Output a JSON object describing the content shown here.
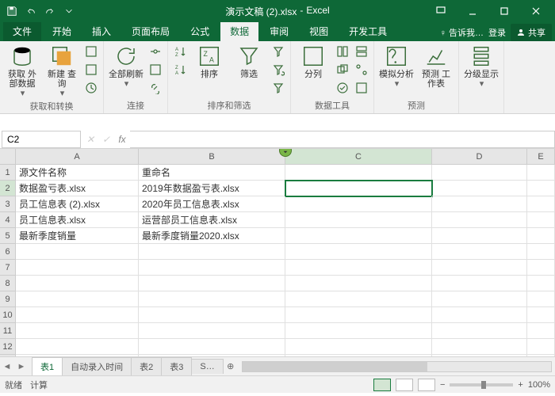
{
  "title": {
    "doc": "演示文稿 (2).xlsx",
    "app": "Excel"
  },
  "qat": {
    "save": "save-icon",
    "undo": "undo-icon",
    "redo": "redo-icon"
  },
  "tabs": {
    "file": "文件",
    "items": [
      "开始",
      "插入",
      "页面布局",
      "公式",
      "数据",
      "审阅",
      "视图",
      "开发工具"
    ],
    "active_index": 4,
    "tell_me": "告诉我…",
    "signin": "登录",
    "share": "共享"
  },
  "ribbon": {
    "groups": [
      {
        "label": "获取和转换",
        "items": [
          {
            "label": "获取\n外部数据",
            "big": true,
            "name": "get-external-data"
          },
          {
            "label": "新建\n查询",
            "big": true,
            "name": "new-query"
          }
        ]
      },
      {
        "label": "连接",
        "items": [
          {
            "label": "全部刷新",
            "big": true,
            "name": "refresh-all"
          }
        ]
      },
      {
        "label": "排序和筛选",
        "items": [
          {
            "label": "",
            "big": false,
            "name": "sort-az"
          },
          {
            "label": "",
            "big": false,
            "name": "sort-za"
          },
          {
            "label": "排序",
            "big": true,
            "name": "sort"
          },
          {
            "label": "筛选",
            "big": true,
            "name": "filter"
          }
        ]
      },
      {
        "label": "数据工具",
        "items": [
          {
            "label": "分列",
            "big": true,
            "name": "text-to-columns"
          }
        ]
      },
      {
        "label": "预测",
        "items": [
          {
            "label": "模拟分析",
            "big": true,
            "name": "what-if"
          },
          {
            "label": "预测\n工作表",
            "big": true,
            "name": "forecast-sheet"
          }
        ]
      },
      {
        "label": "分级显示",
        "items": [
          {
            "label": "分级显示",
            "big": true,
            "name": "outline"
          }
        ]
      }
    ]
  },
  "namebox": {
    "ref": "C2",
    "formula": ""
  },
  "columns": [
    "A",
    "B",
    "C",
    "D",
    "E"
  ],
  "row_count": 13,
  "data": {
    "headers": [
      "源文件名称",
      "重命名"
    ],
    "rows": [
      [
        "数据盈亏表.xlsx",
        "2019年数据盈亏表.xlsx"
      ],
      [
        "员工信息表 (2).xlsx",
        "2020年员工信息表.xlsx"
      ],
      [
        "员工信息表.xlsx",
        "运营部员工信息表.xlsx"
      ],
      [
        "最新季度销量",
        "最新季度销量2020.xlsx"
      ]
    ]
  },
  "active_cell": {
    "col": "C",
    "row": 2
  },
  "sheets": {
    "tabs": [
      "表1",
      "自动录入时间",
      "表2",
      "表3",
      "S…"
    ],
    "active": 0
  },
  "status": {
    "mode": "就绪",
    "calc": "计算",
    "zoom": "100%"
  }
}
